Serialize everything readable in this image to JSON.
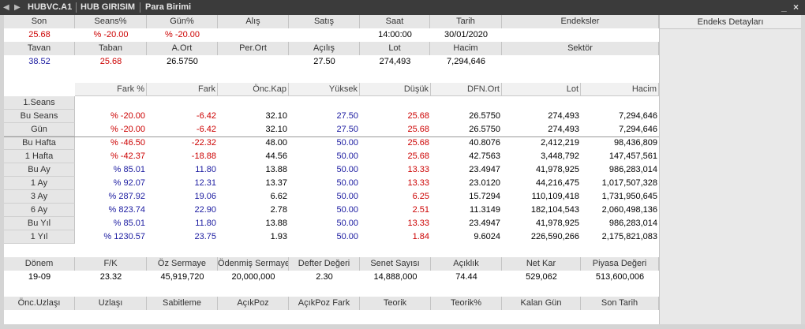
{
  "window": {
    "symbol": "HUBVC.A1",
    "company": "HUB GIRISIM",
    "currency_label": "Para Birimi",
    "minimize": "_",
    "close": "×"
  },
  "top": {
    "headers1": [
      "Son",
      "Seans%",
      "Gün%",
      "Alış",
      "Satış",
      "Saat",
      "Tarih",
      "Endeksler"
    ],
    "values1": [
      "25.68",
      "% -20.00",
      "% -20.00",
      "",
      "",
      "14:00:00",
      "30/01/2020",
      ""
    ],
    "headers2": [
      "Tavan",
      "Taban",
      "A.Ort",
      "Per.Ort",
      "Açılış",
      "Lot",
      "Hacim",
      "Sektör"
    ],
    "values2": [
      "38.52",
      "25.68",
      "26.5750",
      "",
      "27.50",
      "274,493",
      "7,294,646",
      ""
    ]
  },
  "right_panel": {
    "header": "Endeks Detayları"
  },
  "grid": {
    "columns": [
      "Fark %",
      "Fark",
      "Önc.Kap",
      "Yüksek",
      "Düşük",
      "DFN.Ort",
      "Lot",
      "Hacim"
    ],
    "rows": [
      {
        "label": "1.Seans",
        "cells": [
          "",
          "",
          "",
          "",
          "",
          "",
          "",
          ""
        ]
      },
      {
        "label": "Bu Seans",
        "cells": [
          "% -20.00",
          "-6.42",
          "32.10",
          "27.50",
          "25.68",
          "26.5750",
          "274,493",
          "7,294,646"
        ]
      },
      {
        "label": "Gün",
        "cells": [
          "% -20.00",
          "-6.42",
          "32.10",
          "27.50",
          "25.68",
          "26.5750",
          "274,493",
          "7,294,646"
        ]
      },
      {
        "label": "Bu Hafta",
        "cells": [
          "% -46.50",
          "-22.32",
          "48.00",
          "50.00",
          "25.68",
          "40.8076",
          "2,412,219",
          "98,436,809"
        ]
      },
      {
        "label": "1 Hafta",
        "cells": [
          "% -42.37",
          "-18.88",
          "44.56",
          "50.00",
          "25.68",
          "42.7563",
          "3,448,792",
          "147,457,561"
        ]
      },
      {
        "label": "Bu Ay",
        "cells": [
          "% 85.01",
          "11.80",
          "13.88",
          "50.00",
          "13.33",
          "23.4947",
          "41,978,925",
          "986,283,014"
        ]
      },
      {
        "label": "1 Ay",
        "cells": [
          "% 92.07",
          "12.31",
          "13.37",
          "50.00",
          "13.33",
          "23.0120",
          "44,216,475",
          "1,017,507,328"
        ]
      },
      {
        "label": "3 Ay",
        "cells": [
          "% 287.92",
          "19.06",
          "6.62",
          "50.00",
          "6.25",
          "15.7294",
          "110,109,418",
          "1,731,950,645"
        ]
      },
      {
        "label": "6 Ay",
        "cells": [
          "% 823.74",
          "22.90",
          "2.78",
          "50.00",
          "2.51",
          "11.3149",
          "182,104,543",
          "2,060,498,136"
        ]
      },
      {
        "label": "Bu Yıl",
        "cells": [
          "% 85.01",
          "11.80",
          "13.88",
          "50.00",
          "13.33",
          "23.4947",
          "41,978,925",
          "986,283,014"
        ]
      },
      {
        "label": "1 Yıl",
        "cells": [
          "% 1230.57",
          "23.75",
          "1.93",
          "50.00",
          "1.84",
          "9.6024",
          "226,590,266",
          "2,175,821,083"
        ]
      }
    ]
  },
  "fundamentals": {
    "headers": [
      "Dönem",
      "F/K",
      "Öz Sermaye",
      "Ödenmiş Sermaye",
      "Defter Değeri",
      "Senet Sayısı",
      "Açıklık",
      "Net Kar",
      "Piyasa Değeri"
    ],
    "values": [
      "19-09",
      "23.32",
      "45,919,720",
      "20,000,000",
      "2.30",
      "14,888,000",
      "74.44",
      "529,062",
      "513,600,006"
    ]
  },
  "derivatives": {
    "headers": [
      "Önc.Uzlaşı",
      "Uzlaşı",
      "Sabitleme",
      "AçıkPoz",
      "AçıkPoz Fark",
      "Teorik",
      "Teorik%",
      "Kalan Gün",
      "Son Tarih"
    ]
  },
  "colors": {
    "negative": "#cc0000",
    "positive": "#1a1aa0",
    "titlebar": "#3b3b3b"
  }
}
